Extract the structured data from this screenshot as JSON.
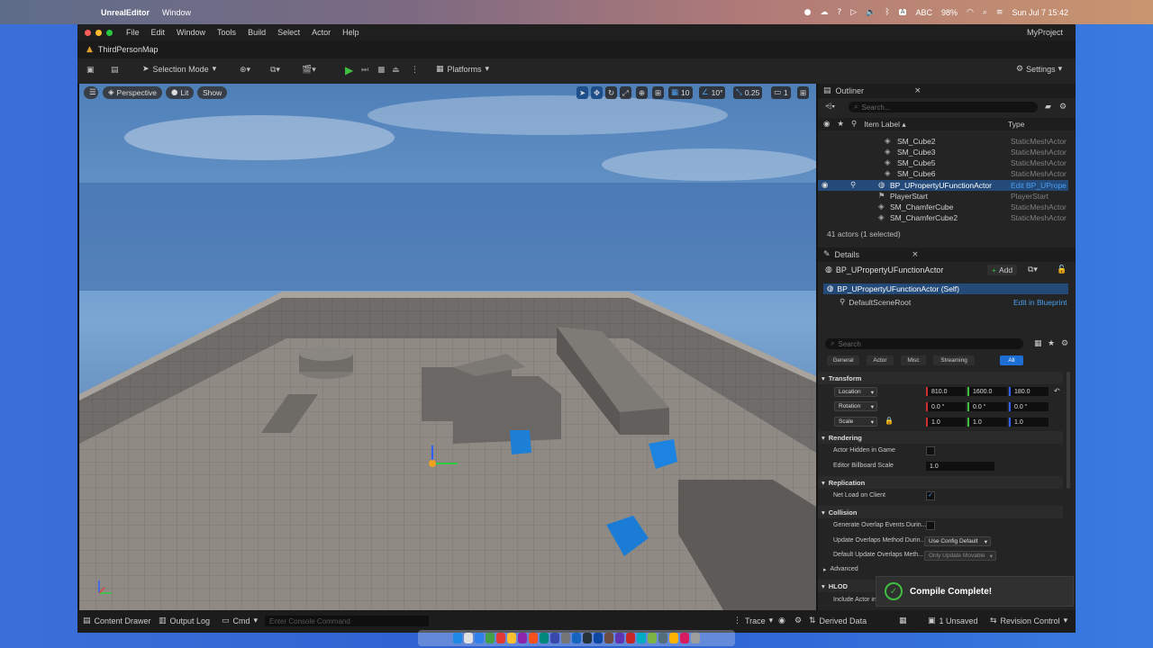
{
  "mac_menubar": {
    "app_name": "UnrealEditor",
    "menu_window": "Window",
    "status": {
      "keyboard": "ABC",
      "battery": "98%",
      "datetime": "Sun Jul 7  15:42"
    }
  },
  "window": {
    "menus": [
      "File",
      "Edit",
      "Window",
      "Tools",
      "Build",
      "Select",
      "Actor",
      "Help"
    ],
    "project": "MyProject",
    "map_tab": "ThirdPersonMap"
  },
  "toolbar": {
    "selection_mode": "Selection Mode",
    "platforms": "Platforms",
    "settings": "Settings"
  },
  "viewport": {
    "perspective": "Perspective",
    "lit": "Lit",
    "show": "Show",
    "grid_snap": "10",
    "rotation_snap": "10°",
    "scale_snap": "0.25",
    "camera_speed": "1"
  },
  "outliner": {
    "title": "Outliner",
    "search_placeholder": "Search...",
    "col_label": "Item Label ▴",
    "col_type": "Type",
    "items": [
      {
        "label": "SM_Cube2",
        "type": "StaticMeshActor"
      },
      {
        "label": "SM_Cube3",
        "type": "StaticMeshActor"
      },
      {
        "label": "SM_Cube5",
        "type": "StaticMeshActor"
      },
      {
        "label": "SM_Cube6",
        "type": "StaticMeshActor"
      },
      {
        "label": "BP_UPropertyUFunctionActor",
        "type": "Edit BP_UPropertyUFunctionActor"
      },
      {
        "label": "PlayerStart",
        "type": "PlayerStart"
      },
      {
        "label": "SM_ChamferCube",
        "type": "StaticMeshActor"
      },
      {
        "label": "SM_ChamferCube2",
        "type": "StaticMeshActor"
      }
    ],
    "summary": "41 actors (1 selected)"
  },
  "details": {
    "title": "Details",
    "actor_name": "BP_UPropertyUFunctionActor",
    "add_label": "Add",
    "self_component": "BP_UPropertyUFunctionActor (Self)",
    "root_component": "DefaultSceneRoot",
    "edit_in_blueprint": "Edit in Blueprint",
    "search_placeholder": "Search",
    "filter_tabs": [
      "General",
      "Actor",
      "Misc",
      "Streaming",
      "All"
    ],
    "sections": {
      "transform": "Transform",
      "rendering": "Rendering",
      "replication": "Replication",
      "collision": "Collision",
      "advanced": "Advanced",
      "hlod": "HLOD"
    },
    "location": {
      "label": "Location",
      "x": "810.0",
      "y": "1600.0",
      "z": "180.0"
    },
    "rotation": {
      "label": "Rotation",
      "x": "0.0 °",
      "y": "0.0 °",
      "z": "0.0 °"
    },
    "scale": {
      "label": "Scale",
      "x": "1.0",
      "y": "1.0",
      "z": "1.0"
    },
    "actor_hidden": "Actor Hidden in Game",
    "billboard_scale": {
      "label": "Editor Billboard Scale",
      "value": "1.0"
    },
    "net_load": "Net Load on Client",
    "gen_overlap": "Generate Overlap Events Durin...",
    "update_overlaps": {
      "label": "Update Overlaps Method Durin...",
      "value": "Use Config Default"
    },
    "default_update": {
      "label": "Default Update Overlaps Meth...",
      "value": "Only Update Movable"
    },
    "include_actor": "Include Actor in HLOD"
  },
  "toast": "Compile Complete!",
  "bottom": {
    "content_drawer": "Content Drawer",
    "output_log": "Output Log",
    "cmd": "Cmd",
    "console_placeholder": "Enter Console Command",
    "trace": "Trace",
    "derived_data": "Derived Data",
    "unsaved": "1 Unsaved",
    "revision_control": "Revision Control"
  }
}
